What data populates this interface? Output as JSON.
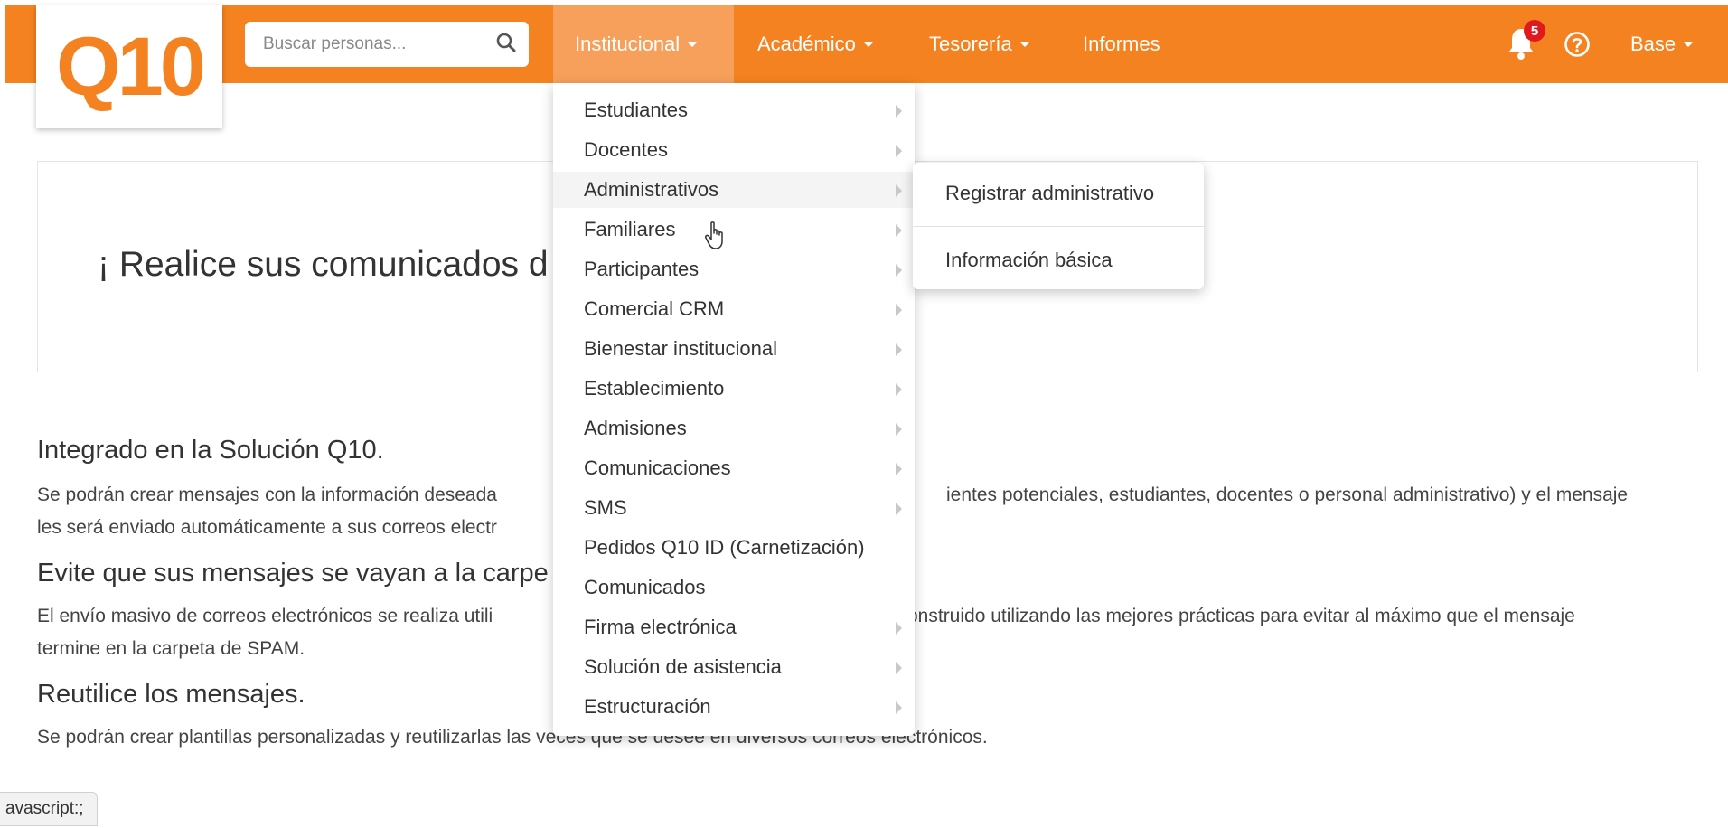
{
  "logo": {
    "text": "Q10"
  },
  "search": {
    "placeholder": "Buscar personas..."
  },
  "nav": {
    "institucional": "Institucional",
    "academico": "Académico",
    "tesoreria": "Tesorería",
    "informes": "Informes",
    "base": "Base"
  },
  "notifications": {
    "count": "5"
  },
  "banner": {
    "title": "¡ Realice sus comunicados d"
  },
  "sections": [
    {
      "title": "Integrado en la Solución Q10.",
      "line1_a": "Se podrán crear mensajes con la información deseada",
      "line1_b": "ientes potenciales, estudiantes, docentes o personal administrativo) y el mensaje",
      "line2_a": "les será enviado automáticamente a sus correos electr"
    },
    {
      "title": "Evite que sus mensajes se vayan a la carpe",
      "line1_a": "El envío masivo de correos electrónicos se realiza utili",
      "line1_b": "onstruido utilizando las mejores prácticas para evitar al máximo que el mensaje",
      "line2_a": "termine en la carpeta de SPAM."
    },
    {
      "title": "Reutilice los mensajes.",
      "line1_a": "Se podrán crear plantillas personalizadas y reutilizarlas las veces que se desee en diversos correos electrónicos."
    }
  ],
  "dropdown": {
    "items": [
      {
        "label": "Estudiantes",
        "submenu": true
      },
      {
        "label": "Docentes",
        "submenu": true
      },
      {
        "label": "Administrativos",
        "submenu": true
      },
      {
        "label": "Familiares",
        "submenu": true
      },
      {
        "label": "Participantes",
        "submenu": true
      },
      {
        "label": "Comercial CRM",
        "submenu": true
      },
      {
        "label": "Bienestar institucional",
        "submenu": true
      },
      {
        "label": "Establecimiento",
        "submenu": true
      },
      {
        "label": "Admisiones",
        "submenu": true
      },
      {
        "label": "Comunicaciones",
        "submenu": true
      },
      {
        "label": "SMS",
        "submenu": true
      },
      {
        "label": "Pedidos Q10 ID (Carnetización)",
        "submenu": false
      },
      {
        "label": "Comunicados",
        "submenu": false
      },
      {
        "label": "Firma electrónica",
        "submenu": true
      },
      {
        "label": "Solución de asistencia",
        "submenu": true
      },
      {
        "label": "Estructuración",
        "submenu": true
      }
    ]
  },
  "submenu": {
    "register": "Registrar administrativo",
    "basic_info": "Información básica"
  },
  "status": {
    "url": "avascript:;"
  },
  "colors": {
    "brand": "#f58220",
    "badge": "#e0191f"
  }
}
